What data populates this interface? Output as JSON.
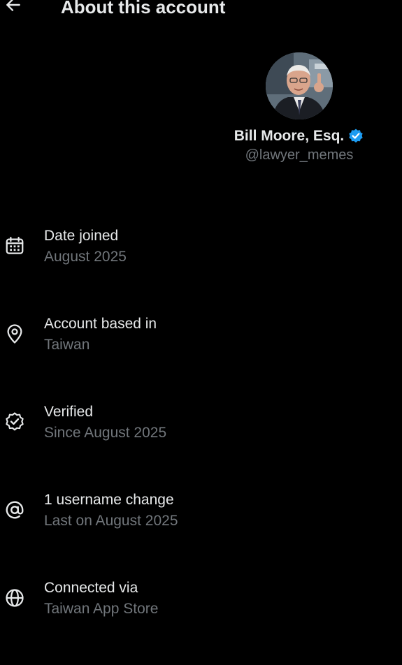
{
  "header": {
    "title": "About this account",
    "back_icon": "arrow-left-icon"
  },
  "profile": {
    "display_name": "Bill Moore, Esq.",
    "handle": "@lawyer_memes",
    "verified_color": "#1d9bf0",
    "verified_icon": "verified-badge-icon"
  },
  "colors": {
    "background": "#000000",
    "primary_text": "#e7e9ea",
    "secondary_text": "#71767b",
    "accent": "#1d9bf0"
  },
  "items": [
    {
      "icon": "calendar-icon",
      "title": "Date joined",
      "subtitle": "August 2025"
    },
    {
      "icon": "location-pin-icon",
      "title": "Account based in",
      "subtitle": "Taiwan"
    },
    {
      "icon": "verified-outline-icon",
      "title": "Verified",
      "subtitle": "Since August 2025"
    },
    {
      "icon": "at-sign-icon",
      "title": "1 username change",
      "subtitle": "Last on August 2025"
    },
    {
      "icon": "globe-icon",
      "title": "Connected via",
      "subtitle": "Taiwan App Store"
    }
  ]
}
